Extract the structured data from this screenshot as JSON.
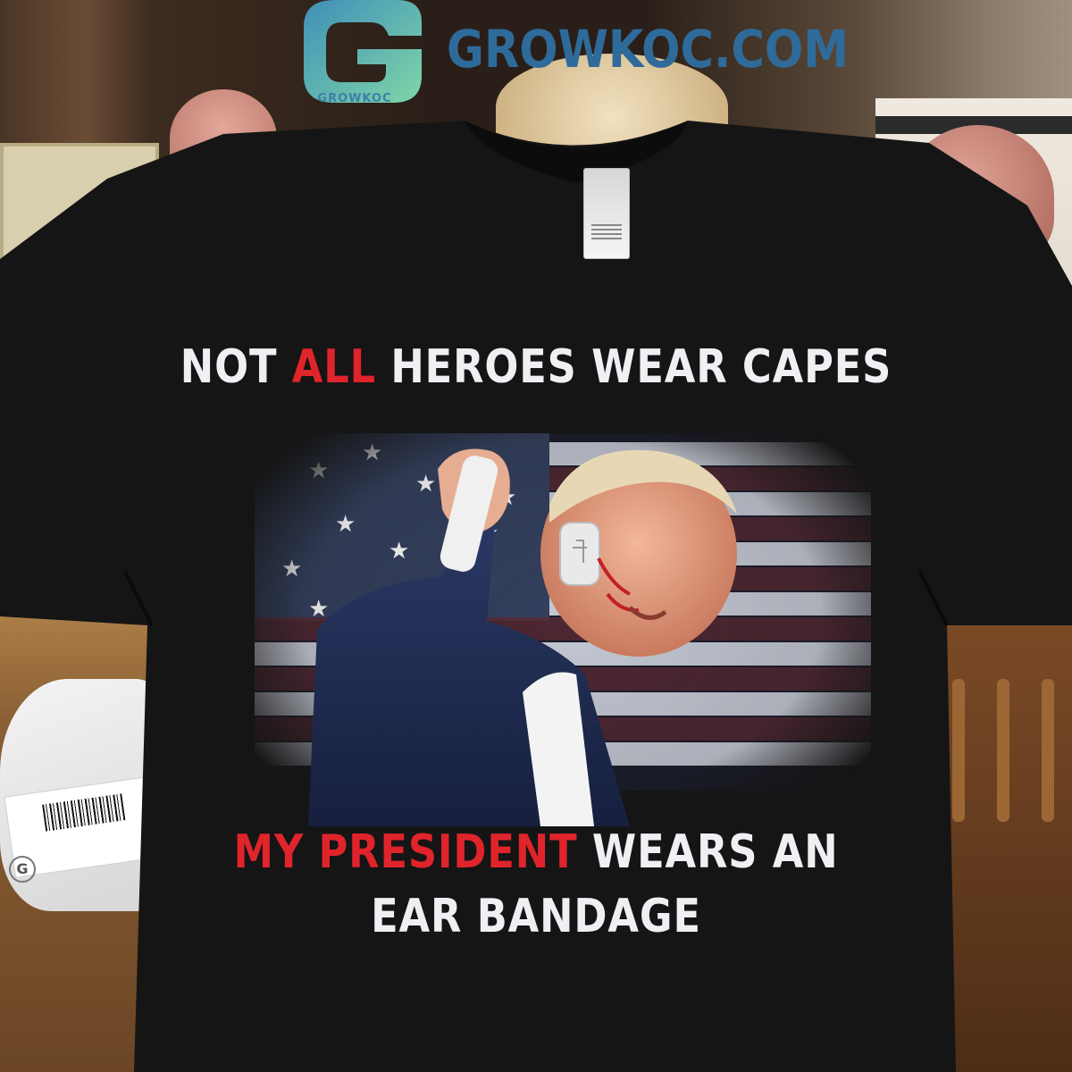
{
  "watermark": {
    "site_name": "GROWKOC.COM",
    "logo_caption": "GROWKOC",
    "logo_letter": "G",
    "brand_color": "#2e6b9a",
    "logo_gradient": [
      "#3f8fb8",
      "#7fd6a8"
    ]
  },
  "shirt_print": {
    "line1": {
      "pre": "NOT ",
      "accent": "ALL",
      "post": " HEROES WEAR CAPES"
    },
    "line2": {
      "accent": "MY PRESIDENT",
      "post": " WEARS AN"
    },
    "line3": "EAR BANDAGE",
    "text_color": "#eef0f4",
    "accent_color": "#e0242b",
    "shirt_color": "#151515"
  },
  "shipping_bag_letter": "G"
}
